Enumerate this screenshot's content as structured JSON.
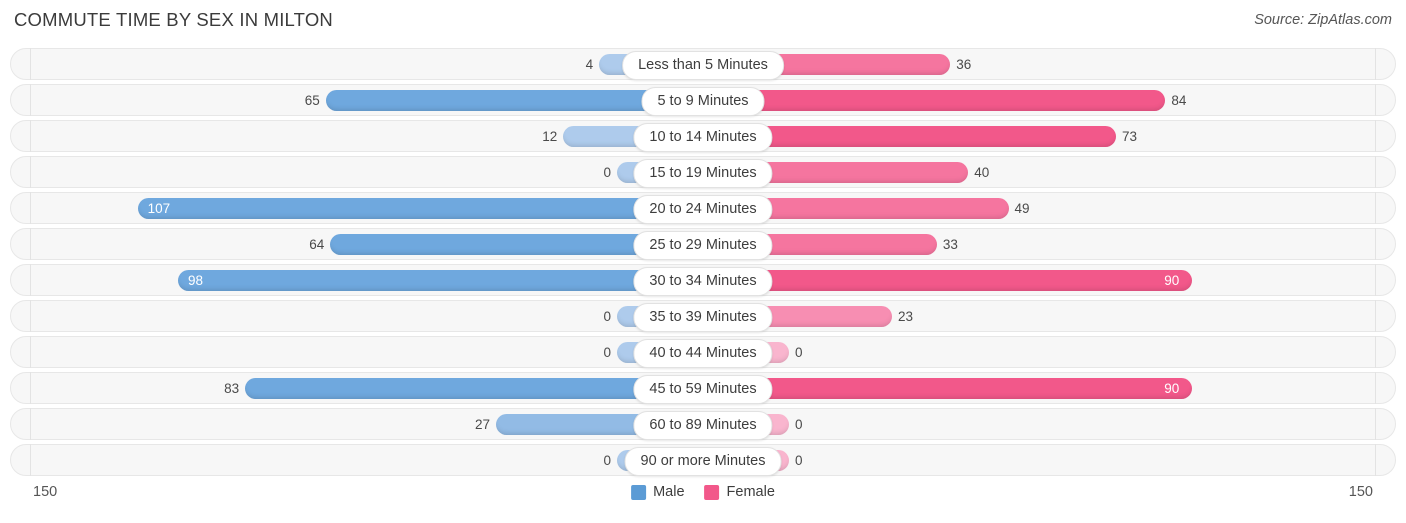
{
  "header": {
    "title": "COMMUTE TIME BY SEX IN MILTON",
    "source": "Source: ZipAtlas.com"
  },
  "legend": {
    "male_label": "Male",
    "female_label": "Female",
    "male_color": "#5B9BD5",
    "female_color": "#F2588A"
  },
  "axis": {
    "min_label": "150",
    "max_label": "150"
  },
  "chart_data": {
    "type": "bar",
    "orientation": "horizontal-diverging",
    "title": "COMMUTE TIME BY SEX IN MILTON",
    "subtitle": "Source: ZipAtlas.com",
    "xlabel": "",
    "ylabel": "",
    "xlim": [
      -150,
      150
    ],
    "axis_tick_labels": [
      "150",
      "150"
    ],
    "grid": false,
    "legend_position": "bottom-center",
    "categories": [
      "Less than 5 Minutes",
      "5 to 9 Minutes",
      "10 to 14 Minutes",
      "15 to 19 Minutes",
      "20 to 24 Minutes",
      "25 to 29 Minutes",
      "30 to 34 Minutes",
      "35 to 39 Minutes",
      "40 to 44 Minutes",
      "45 to 59 Minutes",
      "60 to 89 Minutes",
      "90 or more Minutes"
    ],
    "series": [
      {
        "name": "Male",
        "color": "#5B9BD5",
        "values": [
          4,
          65,
          12,
          0,
          107,
          64,
          98,
          0,
          0,
          83,
          27,
          0
        ]
      },
      {
        "name": "Female",
        "color": "#F2588A",
        "values": [
          36,
          84,
          73,
          40,
          49,
          33,
          90,
          23,
          0,
          90,
          0,
          0
        ]
      }
    ]
  },
  "rows": [
    {
      "category": "Less than 5 Minutes",
      "male": {
        "value": 4,
        "label": "4",
        "color": "#AECBEC",
        "inside": false
      },
      "female": {
        "value": 36,
        "label": "36",
        "color": "#F5759F",
        "inside": false
      }
    },
    {
      "category": "5 to 9 Minutes",
      "male": {
        "value": 65,
        "label": "65",
        "color": "#6FA8DE",
        "inside": false
      },
      "female": {
        "value": 84,
        "label": "84",
        "color": "#F2588A",
        "inside": false
      }
    },
    {
      "category": "10 to 14 Minutes",
      "male": {
        "value": 12,
        "label": "12",
        "color": "#AECBEC",
        "inside": false
      },
      "female": {
        "value": 73,
        "label": "73",
        "color": "#F2588A",
        "inside": false
      }
    },
    {
      "category": "15 to 19 Minutes",
      "male": {
        "value": 0,
        "label": "0",
        "color": "#AECBEC",
        "inside": false
      },
      "female": {
        "value": 40,
        "label": "40",
        "color": "#F5759F",
        "inside": false
      }
    },
    {
      "category": "20 to 24 Minutes",
      "male": {
        "value": 107,
        "label": "107",
        "color": "#6FA8DE",
        "inside": true
      },
      "female": {
        "value": 49,
        "label": "49",
        "color": "#F5759F",
        "inside": false
      }
    },
    {
      "category": "25 to 29 Minutes",
      "male": {
        "value": 64,
        "label": "64",
        "color": "#6FA8DE",
        "inside": false
      },
      "female": {
        "value": 33,
        "label": "33",
        "color": "#F5759F",
        "inside": false
      }
    },
    {
      "category": "30 to 34 Minutes",
      "male": {
        "value": 98,
        "label": "98",
        "color": "#6FA8DE",
        "inside": true
      },
      "female": {
        "value": 90,
        "label": "90",
        "color": "#F2588A",
        "inside": true
      }
    },
    {
      "category": "35 to 39 Minutes",
      "male": {
        "value": 0,
        "label": "0",
        "color": "#AECBEC",
        "inside": false
      },
      "female": {
        "value": 23,
        "label": "23",
        "color": "#F78EB2",
        "inside": false
      }
    },
    {
      "category": "40 to 44 Minutes",
      "male": {
        "value": 0,
        "label": "0",
        "color": "#AECBEC",
        "inside": false
      },
      "female": {
        "value": 0,
        "label": "0",
        "color": "#F9B5CE",
        "inside": false
      }
    },
    {
      "category": "45 to 59 Minutes",
      "male": {
        "value": 83,
        "label": "83",
        "color": "#6FA8DE",
        "inside": false
      },
      "female": {
        "value": 90,
        "label": "90",
        "color": "#F2588A",
        "inside": true
      }
    },
    {
      "category": "60 to 89 Minutes",
      "male": {
        "value": 27,
        "label": "27",
        "color": "#92BBE5",
        "inside": false
      },
      "female": {
        "value": 0,
        "label": "0",
        "color": "#F9B5CE",
        "inside": false
      }
    },
    {
      "category": "90 or more Minutes",
      "male": {
        "value": 0,
        "label": "0",
        "color": "#AECBEC",
        "inside": false
      },
      "female": {
        "value": 0,
        "label": "0",
        "color": "#F9B5CE",
        "inside": false
      }
    }
  ]
}
